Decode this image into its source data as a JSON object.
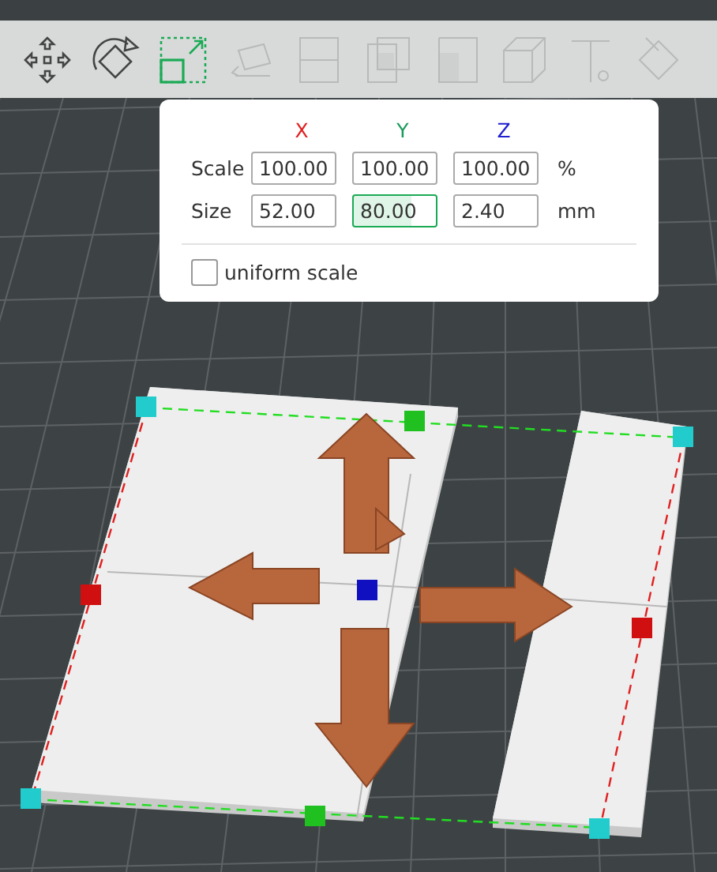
{
  "toolbar": {
    "tools": [
      {
        "kind": "move",
        "selected": false,
        "disabled": false
      },
      {
        "kind": "rotate",
        "selected": false,
        "disabled": false
      },
      {
        "kind": "scale",
        "selected": true,
        "disabled": false
      },
      {
        "kind": "lay-flat",
        "selected": false,
        "disabled": true
      },
      {
        "kind": "cut",
        "selected": false,
        "disabled": true
      },
      {
        "kind": "support",
        "selected": false,
        "disabled": true
      },
      {
        "kind": "seam",
        "selected": false,
        "disabled": true
      },
      {
        "kind": "cube",
        "selected": false,
        "disabled": true
      },
      {
        "kind": "text",
        "selected": false,
        "disabled": true
      },
      {
        "kind": "paint",
        "selected": false,
        "disabled": true
      }
    ]
  },
  "scale_panel": {
    "axes": [
      {
        "label": "X",
        "color": "#e02020"
      },
      {
        "label": "Y",
        "color": "#1a9a5a"
      },
      {
        "label": "Z",
        "color": "#2020d0"
      }
    ],
    "rows": [
      {
        "label": "Scale",
        "unit": "%",
        "fields": [
          {
            "value": "100.00",
            "selected": false
          },
          {
            "value": "100.00",
            "selected": false
          },
          {
            "value": "100.00",
            "selected": false
          }
        ]
      },
      {
        "label": "Size",
        "unit": "mm",
        "fields": [
          {
            "value": "52.00",
            "selected": false
          },
          {
            "value": "80.00",
            "selected": true
          },
          {
            "value": "2.40",
            "selected": false
          }
        ]
      }
    ],
    "uniform_scale": {
      "label": "uniform scale",
      "checked": false
    }
  }
}
